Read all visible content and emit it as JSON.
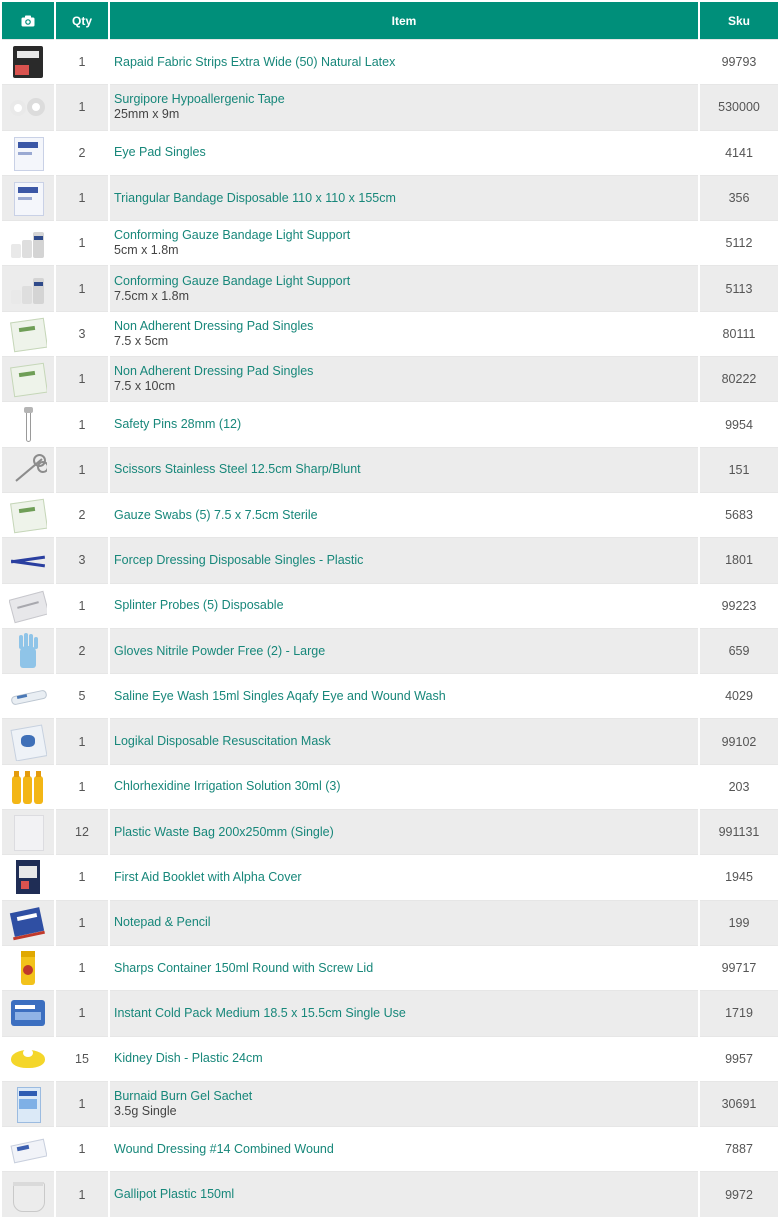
{
  "header": {
    "camera_icon": "camera-icon",
    "qty": "Qty",
    "item": "Item",
    "sku": "Sku"
  },
  "colors": {
    "header_bg": "#008f7a",
    "link_text": "#17877a",
    "row_alt": "#ececec"
  },
  "rows": [
    {
      "qty": "1",
      "name": "Rapaid Fabric Strips Extra Wide (50) Natural Latex",
      "sub": "",
      "sku": "99793",
      "thumb": "box-dark"
    },
    {
      "qty": "1",
      "name": "Surgipore Hypoallergenic Tape",
      "sub": "25mm x 9m",
      "sku": "530000",
      "thumb": "tape-rolls"
    },
    {
      "qty": "2",
      "name": "Eye Pad Singles",
      "sub": "",
      "sku": "4141",
      "thumb": "white-packet"
    },
    {
      "qty": "1",
      "name": "Triangular Bandage Disposable 110 x 110 x 155cm",
      "sub": "",
      "sku": "356",
      "thumb": "white-packet"
    },
    {
      "qty": "1",
      "name": "Conforming Gauze Bandage Light Support",
      "sub": "5cm x 1.8m",
      "sku": "5112",
      "thumb": "bandage-rolls"
    },
    {
      "qty": "1",
      "name": "Conforming Gauze Bandage Light Support",
      "sub": "7.5cm x 1.8m",
      "sku": "5113",
      "thumb": "bandage-rolls"
    },
    {
      "qty": "3",
      "name": "Non Adherent Dressing Pad Singles",
      "sub": "7.5 x 5cm",
      "sku": "80111",
      "thumb": "green-packet"
    },
    {
      "qty": "1",
      "name": "Non Adherent Dressing Pad Singles",
      "sub": "7.5 x 10cm",
      "sku": "80222",
      "thumb": "green-packet"
    },
    {
      "qty": "1",
      "name": "Safety Pins 28mm (12)",
      "sub": "",
      "sku": "9954",
      "thumb": "safety-pin"
    },
    {
      "qty": "1",
      "name": "Scissors Stainless Steel 12.5cm Sharp/Blunt",
      "sub": "",
      "sku": "151",
      "thumb": "scissors"
    },
    {
      "qty": "2",
      "name": "Gauze Swabs (5) 7.5 x 7.5cm Sterile",
      "sub": "",
      "sku": "5683",
      "thumb": "green-packet"
    },
    {
      "qty": "3",
      "name": "Forcep Dressing Disposable Singles - Plastic",
      "sub": "",
      "sku": "1801",
      "thumb": "forceps"
    },
    {
      "qty": "1",
      "name": "Splinter Probes (5) Disposable",
      "sub": "",
      "sku": "99223",
      "thumb": "probes"
    },
    {
      "qty": "2",
      "name": "Gloves Nitrile Powder Free (2) - Large",
      "sub": "",
      "sku": "659",
      "thumb": "glove"
    },
    {
      "qty": "5",
      "name": "Saline Eye Wash 15ml Singles Aqafy Eye and Wound Wash",
      "sub": "",
      "sku": "4029",
      "thumb": "ampoule"
    },
    {
      "qty": "1",
      "name": "Logikal Disposable Resuscitation Mask",
      "sub": "",
      "sku": "99102",
      "thumb": "mask-packet"
    },
    {
      "qty": "1",
      "name": "Chlorhexidine Irrigation Solution 30ml (3)",
      "sub": "",
      "sku": "203",
      "thumb": "yellow-vials"
    },
    {
      "qty": "12",
      "name": "Plastic Waste Bag 200x250mm (Single)",
      "sub": "",
      "sku": "991131",
      "thumb": "plastic-bag"
    },
    {
      "qty": "1",
      "name": "First Aid Booklet with Alpha Cover",
      "sub": "",
      "sku": "1945",
      "thumb": "booklet"
    },
    {
      "qty": "1",
      "name": "Notepad & Pencil",
      "sub": "",
      "sku": "199",
      "thumb": "notepad"
    },
    {
      "qty": "1",
      "name": "Sharps Container 150ml Round with Screw Lid",
      "sub": "",
      "sku": "99717",
      "thumb": "sharps"
    },
    {
      "qty": "1",
      "name": "Instant Cold Pack Medium 18.5 x 15.5cm Single Use",
      "sub": "",
      "sku": "1719",
      "thumb": "cold-pack"
    },
    {
      "qty": "15",
      "name": "Kidney Dish - Plastic 24cm",
      "sub": "",
      "sku": "9957",
      "thumb": "kidney-dish"
    },
    {
      "qty": "1",
      "name": "Burnaid Burn Gel Sachet",
      "sub": "3.5g Single",
      "sku": "30691",
      "thumb": "sachet"
    },
    {
      "qty": "1",
      "name": "Wound Dressing #14 Combined Wound",
      "sub": "",
      "sku": "7887",
      "thumb": "dressing"
    },
    {
      "qty": "1",
      "name": "Gallipot Plastic 150ml",
      "sub": "",
      "sku": "9972",
      "thumb": "gallipot"
    }
  ]
}
